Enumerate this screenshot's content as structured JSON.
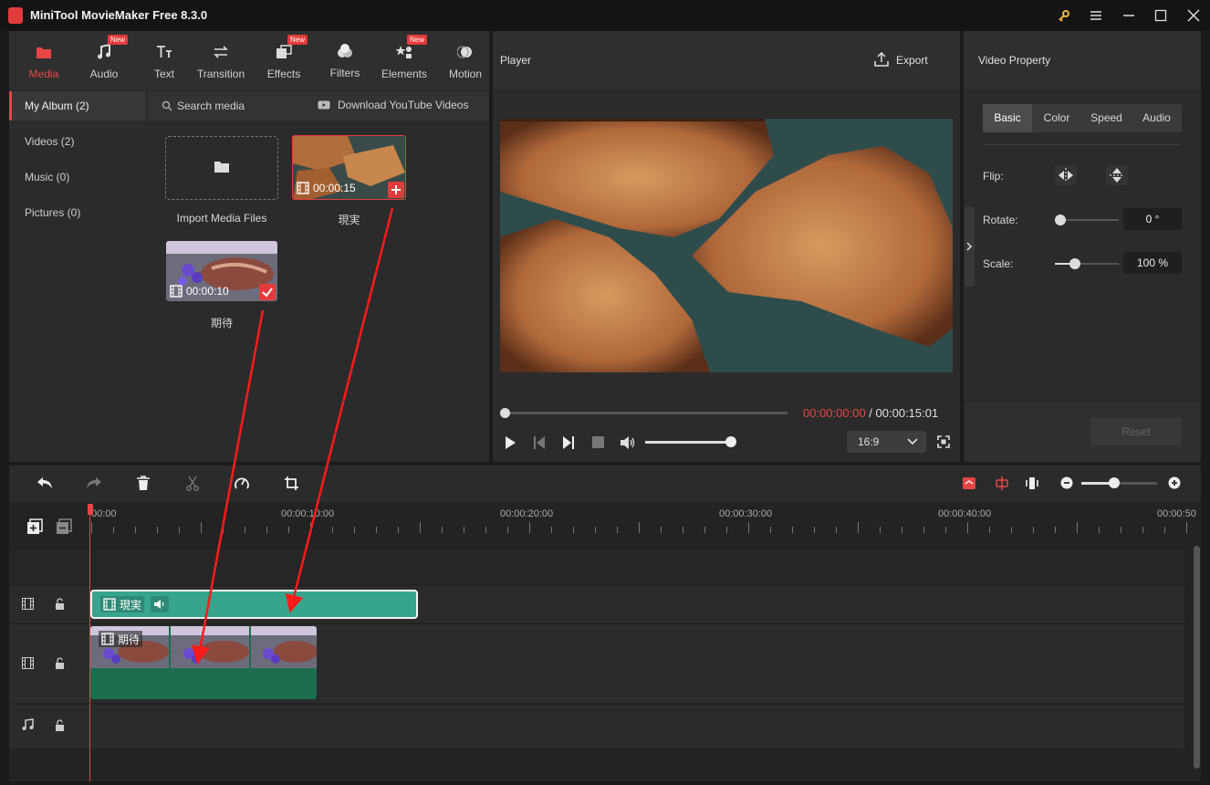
{
  "window": {
    "title": "MiniTool MovieMaker Free 8.3.0"
  },
  "tabs": [
    {
      "label": "Media",
      "icon": "media-icon",
      "active": true,
      "new": false
    },
    {
      "label": "Audio",
      "icon": "audio-icon",
      "active": false,
      "new": true
    },
    {
      "label": "Text",
      "icon": "text-icon",
      "active": false,
      "new": false
    },
    {
      "label": "Transition",
      "icon": "transition-icon",
      "active": false,
      "new": false
    },
    {
      "label": "Effects",
      "icon": "effects-icon",
      "active": false,
      "new": true
    },
    {
      "label": "Filters",
      "icon": "filters-icon",
      "active": false,
      "new": false
    },
    {
      "label": "Elements",
      "icon": "elements-icon",
      "active": false,
      "new": true
    },
    {
      "label": "Motion",
      "icon": "motion-icon",
      "active": false,
      "new": false
    }
  ],
  "badge_new": "New",
  "sidebar": {
    "items": [
      {
        "label": "My Album (2)"
      },
      {
        "label": "Videos (2)"
      },
      {
        "label": "Music (0)"
      },
      {
        "label": "Pictures (0)"
      }
    ]
  },
  "search": {
    "placeholder": "Search media",
    "download_label": "Download YouTube Videos"
  },
  "media": {
    "import_label": "Import Media Files",
    "items": [
      {
        "name": "現実",
        "duration": "00:00:15"
      },
      {
        "name": "期待",
        "duration": "00:00:10"
      }
    ]
  },
  "player": {
    "title": "Player",
    "export_label": "Export",
    "current_time": "00:00:00:00",
    "separator": " / ",
    "total_time": "00:00:15:01",
    "aspect": "16:9",
    "progress": 0,
    "volume": 1.0
  },
  "property": {
    "title": "Video Property",
    "tabs": [
      "Basic",
      "Color",
      "Speed",
      "Audio"
    ],
    "active_tab": "Basic",
    "flip_label": "Flip:",
    "rotate_label": "Rotate:",
    "rotate_value": "0 °",
    "scale_label": "Scale:",
    "scale_value": "100 %",
    "reset_label": "Reset"
  },
  "timeline": {
    "ruler": [
      "00:00",
      "00:00:10:00",
      "00:00:20:00",
      "00:00:30:00",
      "00:00:40:00",
      "00:00:50"
    ],
    "clips": [
      {
        "name": "現実",
        "track": "video-1"
      },
      {
        "name": "期待",
        "track": "video-2"
      }
    ]
  },
  "colors": {
    "accent": "#e84646",
    "clip_teal": "#36a58c",
    "clip_green": "#1c6e4e",
    "annotation_arrow": "#ff1a1a"
  }
}
